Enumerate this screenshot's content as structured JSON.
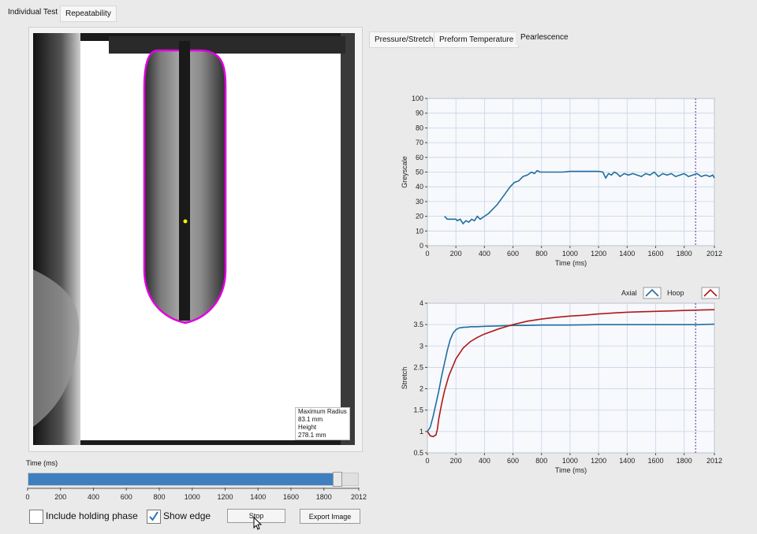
{
  "top_tabs": {
    "individual_test": "Individual Test",
    "repeatability": "Repeatability"
  },
  "chart_tabs": {
    "pressure_stretch": "Pressure/Stretch",
    "preform_temperature": "Preform Temperature",
    "pearlescence": "Pearlescence"
  },
  "image_panel": {
    "overlay": {
      "label1": "Maximum Radius",
      "value1": "83.1 mm",
      "label2": "Height",
      "value2": "278.1 mm"
    },
    "edge_color": "#e000e0",
    "marker_color": "#ffee00"
  },
  "time_slider": {
    "label": "Time (ms)",
    "ticks": [
      "0",
      "200",
      "400",
      "600",
      "800",
      "1000",
      "1200",
      "1400",
      "1600",
      "1800",
      "2012"
    ],
    "min": 0,
    "max": 2012,
    "value": 1880,
    "fill_color": "#3f7fc0"
  },
  "controls": {
    "include_holding_phase": {
      "label": "Include holding phase",
      "checked": false
    },
    "show_edge": {
      "label": "Show edge",
      "checked": true
    },
    "stop_label": "Stop",
    "export_label": "Export Image"
  },
  "chart_data": [
    {
      "type": "line",
      "xlabel": "Time (ms)",
      "ylabel": "Greyscale",
      "xlim": [
        0,
        2012
      ],
      "ylim": [
        0,
        100
      ],
      "xticks": [
        0,
        200,
        400,
        600,
        800,
        1000,
        1200,
        1400,
        1600,
        1800,
        2012
      ],
      "yticks": [
        0,
        10,
        20,
        30,
        40,
        50,
        60,
        70,
        80,
        90,
        100
      ],
      "grid": true,
      "cursor_x": 1880,
      "series": [
        {
          "color": "#1f6f9f",
          "x": [
            120,
            140,
            160,
            180,
            200,
            210,
            230,
            250,
            270,
            290,
            310,
            330,
            350,
            370,
            400,
            430,
            460,
            490,
            520,
            550,
            580,
            610,
            640,
            670,
            700,
            730,
            750,
            770,
            790,
            800,
            850,
            900,
            950,
            1000,
            1050,
            1100,
            1150,
            1200,
            1230,
            1250,
            1270,
            1290,
            1310,
            1330,
            1350,
            1380,
            1410,
            1440,
            1470,
            1500,
            1530,
            1560,
            1590,
            1620,
            1650,
            1680,
            1710,
            1740,
            1770,
            1800,
            1830,
            1860,
            1890,
            1920,
            1950,
            1980,
            2000,
            2012
          ],
          "y": [
            20,
            18,
            18,
            18,
            18,
            17,
            18,
            15,
            17,
            16,
            18,
            17,
            20,
            18,
            20,
            22,
            25,
            28,
            32,
            36,
            40,
            43,
            44,
            47,
            48,
            50,
            49,
            51,
            50,
            50,
            50,
            50,
            50,
            50.5,
            50.5,
            50.5,
            50.5,
            50.5,
            50,
            46,
            49,
            48,
            50,
            49,
            47,
            49,
            48,
            49,
            48,
            47,
            49,
            48,
            50,
            47,
            49,
            48,
            49,
            47,
            48,
            49,
            47,
            48,
            49,
            47,
            48,
            47,
            48,
            46
          ]
        }
      ]
    },
    {
      "type": "line",
      "xlabel": "Time (ms)",
      "ylabel": "Stretch",
      "xlim": [
        0,
        2012
      ],
      "ylim": [
        0.5,
        4
      ],
      "xticks": [
        0,
        200,
        400,
        600,
        800,
        1000,
        1200,
        1400,
        1600,
        1800,
        2012
      ],
      "yticks": [
        0.5,
        1,
        1.5,
        2,
        2.5,
        3,
        3.5,
        4
      ],
      "grid": true,
      "cursor_x": 1880,
      "legend": {
        "position": "top-right"
      },
      "series": [
        {
          "name": "Axial",
          "color": "#1f6f9f",
          "x": [
            0,
            20,
            40,
            60,
            80,
            100,
            120,
            140,
            160,
            180,
            200,
            220,
            240,
            260,
            280,
            300,
            350,
            400,
            500,
            600,
            700,
            800,
            1000,
            1200,
            1400,
            1600,
            1800,
            1900,
            2012
          ],
          "y": [
            1.0,
            1.1,
            1.35,
            1.65,
            1.95,
            2.3,
            2.6,
            2.9,
            3.15,
            3.3,
            3.38,
            3.42,
            3.43,
            3.44,
            3.44,
            3.45,
            3.45,
            3.46,
            3.47,
            3.48,
            3.48,
            3.49,
            3.49,
            3.5,
            3.5,
            3.5,
            3.5,
            3.5,
            3.51
          ]
        },
        {
          "name": "Hoop",
          "color": "#b01818",
          "x": [
            0,
            20,
            40,
            60,
            70,
            80,
            100,
            120,
            150,
            200,
            250,
            300,
            350,
            400,
            500,
            600,
            700,
            800,
            900,
            1000,
            1100,
            1200,
            1300,
            1400,
            1500,
            1600,
            1700,
            1800,
            1900,
            2012
          ],
          "y": [
            1.0,
            0.9,
            0.88,
            0.92,
            1.05,
            1.3,
            1.65,
            1.95,
            2.3,
            2.7,
            2.95,
            3.1,
            3.2,
            3.28,
            3.4,
            3.5,
            3.58,
            3.63,
            3.67,
            3.7,
            3.72,
            3.75,
            3.77,
            3.79,
            3.8,
            3.81,
            3.82,
            3.83,
            3.84,
            3.85
          ]
        }
      ]
    }
  ]
}
